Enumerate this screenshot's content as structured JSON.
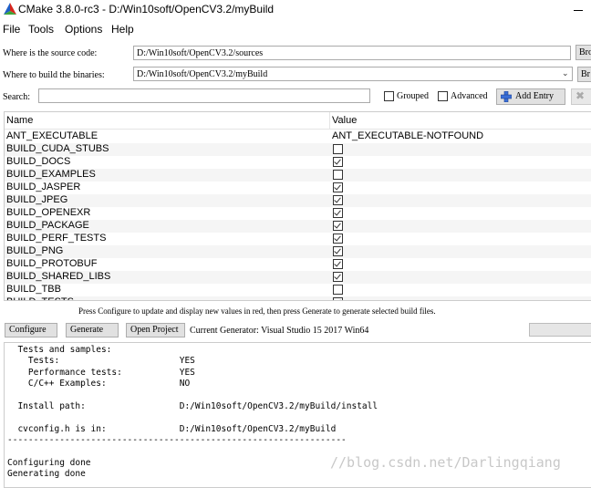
{
  "window": {
    "title": "CMake 3.8.0-rc3 - D:/Win10soft/OpenCV3.2/myBuild"
  },
  "menu": [
    "File",
    "Tools",
    "Options",
    "Help"
  ],
  "source": {
    "label": "Where is the source code:",
    "value": "D:/Win10soft/OpenCV3.2/sources",
    "browse_label": "Bro"
  },
  "build": {
    "label": "Where to build the binaries:",
    "value": "D:/Win10soft/OpenCV3.2/myBuild",
    "browse_label": "Br"
  },
  "search": {
    "label": "Search:",
    "value": ""
  },
  "options": {
    "grouped": "Grouped",
    "advanced": "Advanced",
    "add_entry": "Add Entry"
  },
  "table": {
    "columns": [
      "Name",
      "Value"
    ],
    "rows": [
      {
        "name": "ANT_EXECUTABLE",
        "type": "text",
        "value": "ANT_EXECUTABLE-NOTFOUND"
      },
      {
        "name": "BUILD_CUDA_STUBS",
        "type": "bool",
        "checked": false
      },
      {
        "name": "BUILD_DOCS",
        "type": "bool",
        "checked": true
      },
      {
        "name": "BUILD_EXAMPLES",
        "type": "bool",
        "checked": false
      },
      {
        "name": "BUILD_JASPER",
        "type": "bool",
        "checked": true
      },
      {
        "name": "BUILD_JPEG",
        "type": "bool",
        "checked": true
      },
      {
        "name": "BUILD_OPENEXR",
        "type": "bool",
        "checked": true
      },
      {
        "name": "BUILD_PACKAGE",
        "type": "bool",
        "checked": true
      },
      {
        "name": "BUILD_PERF_TESTS",
        "type": "bool",
        "checked": true
      },
      {
        "name": "BUILD_PNG",
        "type": "bool",
        "checked": true
      },
      {
        "name": "BUILD_PROTOBUF",
        "type": "bool",
        "checked": true
      },
      {
        "name": "BUILD_SHARED_LIBS",
        "type": "bool",
        "checked": true
      },
      {
        "name": "BUILD_TBB",
        "type": "bool",
        "checked": false
      },
      {
        "name": "BUILD_TESTS",
        "type": "bool",
        "checked": true
      }
    ]
  },
  "status_message": "Press Configure to update and display new values in red, then press Generate to generate selected build files.",
  "actions": {
    "configure": "Configure",
    "generate": "Generate",
    "open_project": "Open Project",
    "current_generator": "Current Generator: Visual Studio 15 2017 Win64"
  },
  "output": [
    "  Tests and samples:",
    "    Tests:                       YES",
    "    Performance tests:           YES",
    "    C/C++ Examples:              NO",
    "",
    "  Install path:                  D:/Win10soft/OpenCV3.2/myBuild/install",
    "",
    "  cvconfig.h is in:              D:/Win10soft/OpenCV3.2/myBuild",
    "-----------------------------------------------------------------",
    "",
    "Configuring done",
    "Generating done"
  ],
  "watermark": "//blog.csdn.net/Darlingqiang"
}
